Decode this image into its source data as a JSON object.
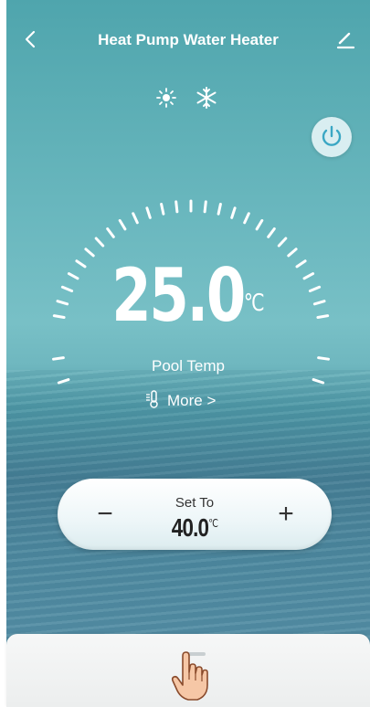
{
  "header": {
    "title": "Heat Pump Water Heater",
    "back_icon": "chevron-left-icon",
    "edit_icon": "edit-icon"
  },
  "modes": {
    "heat_icon": "sun-icon",
    "cool_icon": "snowflake-icon"
  },
  "power": {
    "icon": "power-icon"
  },
  "current": {
    "temperature": "25.0",
    "unit": "℃",
    "label": "Pool Temp"
  },
  "more": {
    "label": "More >",
    "icon": "thermometer-icon"
  },
  "setpoint": {
    "label": "Set To",
    "value": "40.0",
    "unit": "℃",
    "minus": "−",
    "plus": "+"
  },
  "colors": {
    "accent": "#ffffff",
    "sea_top": "#4fa5ad",
    "sea_bottom": "#467f95",
    "power_icon": "#3aa7c4"
  }
}
